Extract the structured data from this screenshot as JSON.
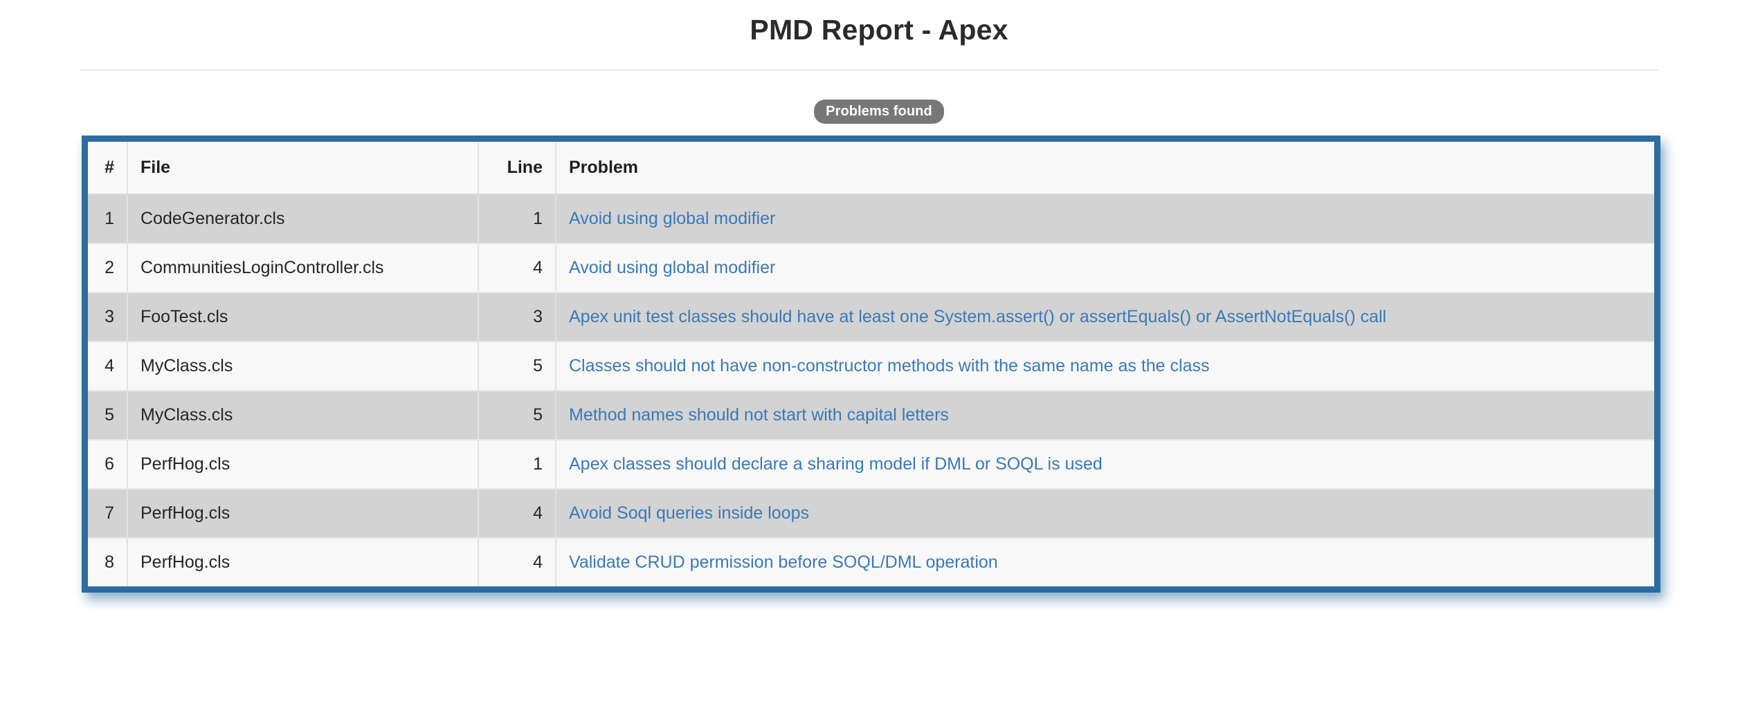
{
  "header": {
    "title": "PMD Report - Apex"
  },
  "status": {
    "badge_label": "Problems found",
    "badge_bg": "#777777",
    "badge_color": "#ffffff"
  },
  "colors": {
    "panel_border": "#2d6ca2",
    "link": "#3a79b8",
    "row_odd": "#d3d3d3",
    "row_even": "#f8f8f8",
    "rule": "#e8e8e8"
  },
  "table": {
    "columns": [
      {
        "key": "num",
        "label": "#",
        "align": "right"
      },
      {
        "key": "file",
        "label": "File",
        "align": "left"
      },
      {
        "key": "line",
        "label": "Line",
        "align": "right"
      },
      {
        "key": "prob",
        "label": "Problem",
        "align": "left"
      }
    ],
    "rows": [
      {
        "num": "1",
        "file": "CodeGenerator.cls",
        "line": "1",
        "problem": "Avoid using global modifier"
      },
      {
        "num": "2",
        "file": "CommunitiesLoginController.cls",
        "line": "4",
        "problem": "Avoid using global modifier"
      },
      {
        "num": "3",
        "file": "FooTest.cls",
        "line": "3",
        "problem": "Apex unit test classes should have at least one System.assert() or assertEquals() or AssertNotEquals() call"
      },
      {
        "num": "4",
        "file": "MyClass.cls",
        "line": "5",
        "problem": "Classes should not have non-constructor methods with the same name as the class"
      },
      {
        "num": "5",
        "file": "MyClass.cls",
        "line": "5",
        "problem": "Method names should not start with capital letters"
      },
      {
        "num": "6",
        "file": "PerfHog.cls",
        "line": "1",
        "problem": "Apex classes should declare a sharing model if DML or SOQL is used"
      },
      {
        "num": "7",
        "file": "PerfHog.cls",
        "line": "4",
        "problem": "Avoid Soql queries inside loops"
      },
      {
        "num": "8",
        "file": "PerfHog.cls",
        "line": "4",
        "problem": "Validate CRUD permission before SOQL/DML operation"
      }
    ]
  }
}
